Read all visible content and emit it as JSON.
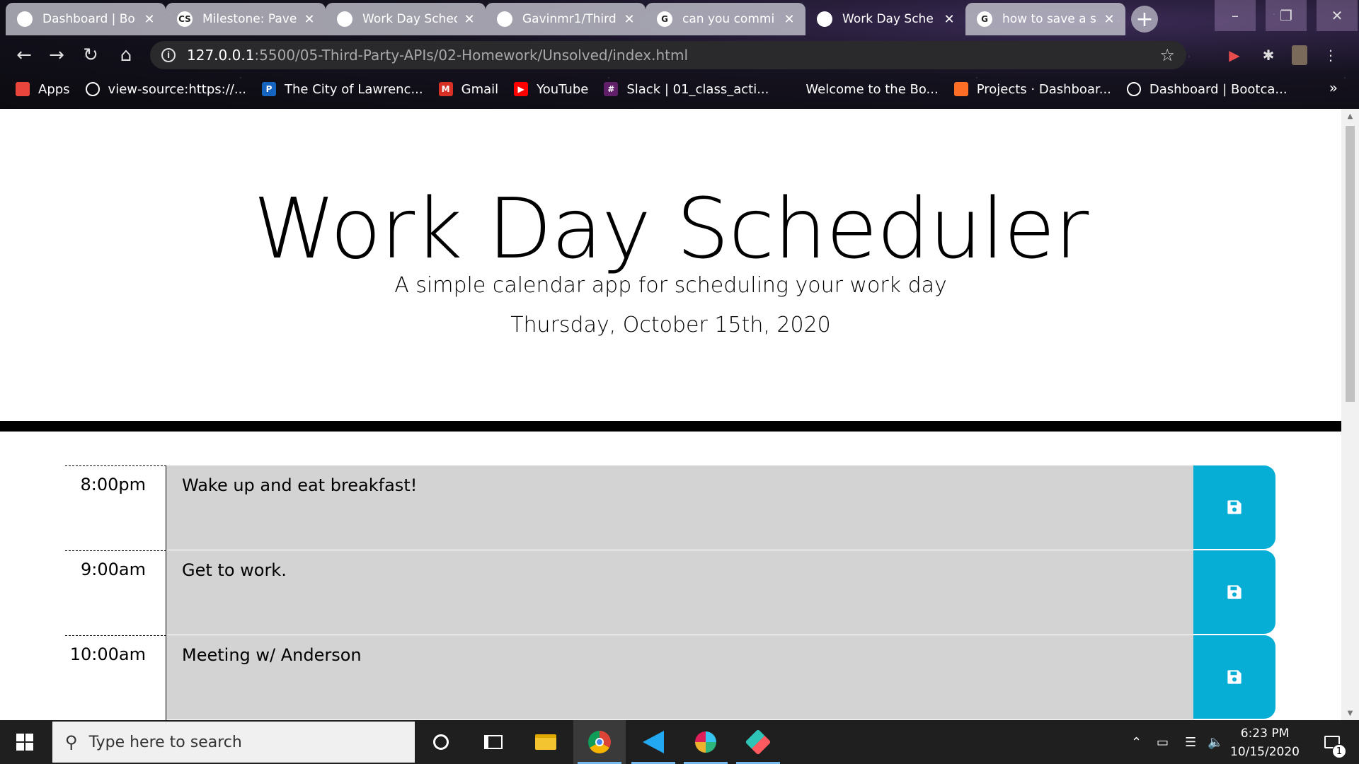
{
  "browser": {
    "tabs": [
      {
        "label": "Dashboard | Bo",
        "favicon": "globe-icon",
        "favicon_text": "",
        "active": false
      },
      {
        "label": "Milestone: Pave",
        "favicon": "cs-icon",
        "favicon_text": "CS",
        "active": false
      },
      {
        "label": "Work Day Schec",
        "favicon": "globe-icon",
        "favicon_text": "",
        "active": false
      },
      {
        "label": "Gavinmr1/Third",
        "favicon": "github-icon",
        "favicon_text": "",
        "active": false
      },
      {
        "label": "can you commi",
        "favicon": "google-icon",
        "favicon_text": "G",
        "active": false
      },
      {
        "label": "Work Day Sche",
        "favicon": "globe-icon",
        "favicon_text": "",
        "active": true
      },
      {
        "label": "how to save a s",
        "favicon": "google-icon",
        "favicon_text": "G",
        "active": false
      }
    ],
    "new_tab_label": "+",
    "address": {
      "host": "127.0.0.1",
      "path": ":5500/05-Third-Party-APIs/02-Homework/Unsolved/index.html"
    },
    "bookmarks": [
      {
        "label": "Apps",
        "icon": "apps-grid-icon",
        "icon_text": "",
        "color": "#e8453c"
      },
      {
        "label": "view-source:https://...",
        "icon": "globe-icon",
        "icon_text": "",
        "color": "#ffffff"
      },
      {
        "label": "The City of Lawrenc...",
        "icon": "p-icon",
        "icon_text": "P",
        "color": "#1565c0"
      },
      {
        "label": "Gmail",
        "icon": "gmail-icon",
        "icon_text": "M",
        "color": "#d93025"
      },
      {
        "label": "YouTube",
        "icon": "youtube-icon",
        "icon_text": "▶",
        "color": "#ff0000"
      },
      {
        "label": "Slack | 01_class_acti...",
        "icon": "slack-icon",
        "icon_text": "#",
        "color": "#611f69"
      },
      {
        "label": "Welcome to the Bo...",
        "icon": "none",
        "icon_text": "",
        "color": ""
      },
      {
        "label": "Projects · Dashboar...",
        "icon": "gitlab-icon",
        "icon_text": "",
        "color": "#fc6d26"
      },
      {
        "label": "Dashboard | Bootca...",
        "icon": "globe-icon",
        "icon_text": "",
        "color": "#ffffff"
      }
    ],
    "bookmarks_overflow": "»"
  },
  "page": {
    "title": "Work Day Scheduler",
    "lead": "A simple calendar app for scheduling your work day",
    "current_day": "Thursday, October 15th, 2020",
    "time_blocks": [
      {
        "hour": "8:00pm",
        "text": "Wake up and eat breakfast!"
      },
      {
        "hour": "9:00am",
        "text": "Get to work."
      },
      {
        "hour": "10:00am",
        "text": "Meeting w/ Anderson"
      }
    ],
    "save_color": "#06aed5",
    "row_color": "#d3d3d3"
  },
  "taskbar": {
    "search_placeholder": "Type here to search",
    "time": "6:23 PM",
    "date": "10/15/2020",
    "notification_count": "1",
    "apps": [
      "cortana-icon",
      "task-view-icon",
      "file-explorer-icon",
      "chrome-icon",
      "vscode-icon",
      "slack-icon",
      "gitkraken-icon"
    ]
  }
}
